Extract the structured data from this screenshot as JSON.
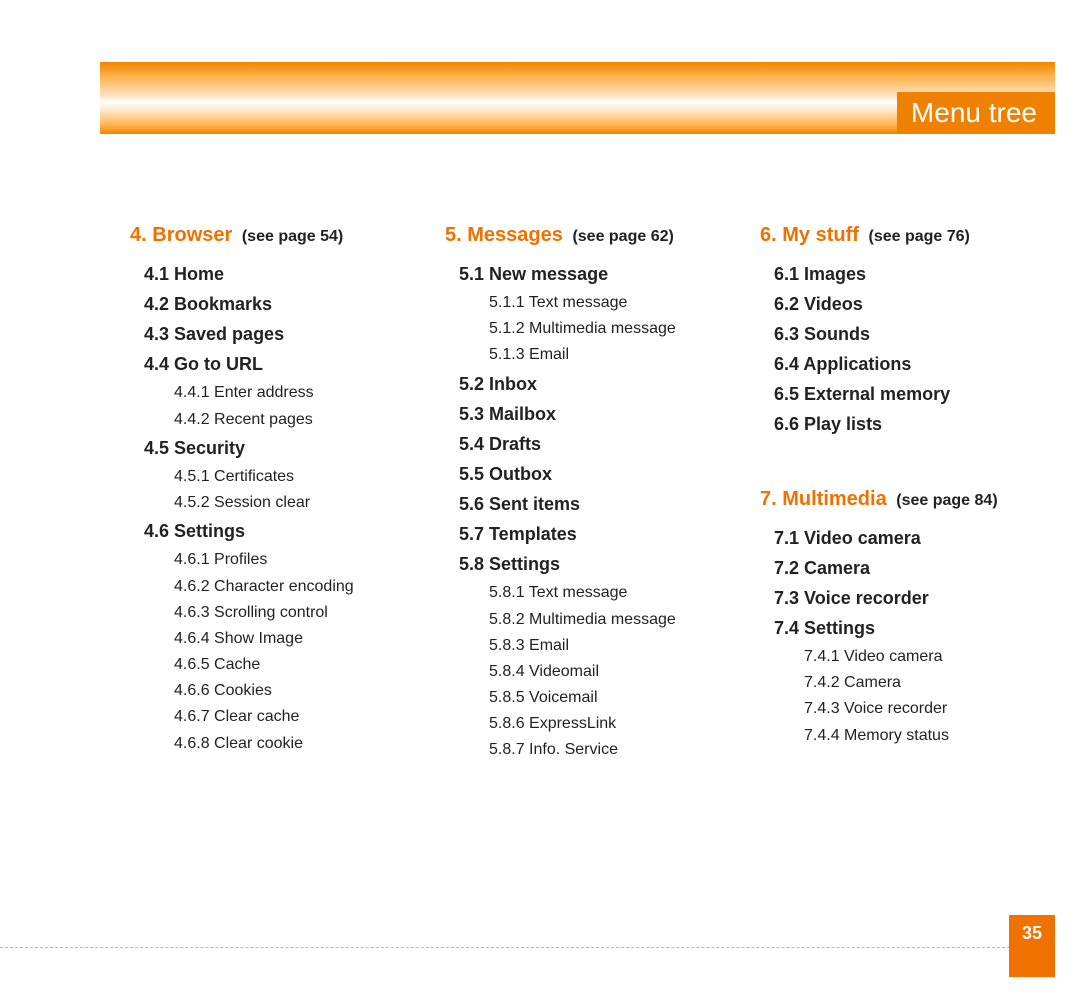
{
  "title": "Menu tree",
  "page_number": "35",
  "columns": [
    {
      "sections": [
        {
          "num": "4.",
          "name": "Browser",
          "see": "see page 54)",
          "items": [
            {
              "t": "4.1 Home",
              "lvl": 2
            },
            {
              "t": "4.2 Bookmarks",
              "lvl": 2
            },
            {
              "t": "4.3 Saved pages",
              "lvl": 2
            },
            {
              "t": "4.4 Go to URL",
              "lvl": 2
            },
            {
              "t": "4.4.1 Enter address",
              "lvl": 3
            },
            {
              "t": "4.4.2 Recent pages",
              "lvl": 3
            },
            {
              "t": "4.5 Security",
              "lvl": 2
            },
            {
              "t": "4.5.1 Certificates",
              "lvl": 3
            },
            {
              "t": "4.5.2 Session clear",
              "lvl": 3
            },
            {
              "t": "4.6 Settings",
              "lvl": 2
            },
            {
              "t": "4.6.1 Profiles",
              "lvl": 3
            },
            {
              "t": "4.6.2 Character encoding",
              "lvl": 3
            },
            {
              "t": "4.6.3 Scrolling control",
              "lvl": 3
            },
            {
              "t": "4.6.4 Show Image",
              "lvl": 3
            },
            {
              "t": "4.6.5 Cache",
              "lvl": 3
            },
            {
              "t": "4.6.6 Cookies",
              "lvl": 3
            },
            {
              "t": "4.6.7 Clear cache",
              "lvl": 3
            },
            {
              "t": "4.6.8 Clear cookie",
              "lvl": 3
            }
          ]
        }
      ]
    },
    {
      "sections": [
        {
          "num": "5.",
          "name": "Messages",
          "see": "see page 62)",
          "items": [
            {
              "t": "5.1 New message",
              "lvl": 2
            },
            {
              "t": "5.1.1 Text message",
              "lvl": 3
            },
            {
              "t": "5.1.2 Multimedia message",
              "lvl": 3
            },
            {
              "t": "5.1.3 Email",
              "lvl": 3
            },
            {
              "t": "5.2 Inbox",
              "lvl": 2
            },
            {
              "t": "5.3 Mailbox",
              "lvl": 2
            },
            {
              "t": "5.4 Drafts",
              "lvl": 2
            },
            {
              "t": "5.5 Outbox",
              "lvl": 2
            },
            {
              "t": "5.6 Sent items",
              "lvl": 2
            },
            {
              "t": "5.7 Templates",
              "lvl": 2
            },
            {
              "t": "5.8 Settings",
              "lvl": 2
            },
            {
              "t": "5.8.1 Text message",
              "lvl": 3
            },
            {
              "t": "5.8.2 Multimedia message",
              "lvl": 3
            },
            {
              "t": "5.8.3 Email",
              "lvl": 3
            },
            {
              "t": "5.8.4 Videomail",
              "lvl": 3
            },
            {
              "t": "5.8.5 Voicemail",
              "lvl": 3
            },
            {
              "t": "5.8.6 ExpressLink",
              "lvl": 3
            },
            {
              "t": "5.8.7 Info. Service",
              "lvl": 3
            }
          ]
        }
      ]
    },
    {
      "sections": [
        {
          "num": "6.",
          "name": "My stuff",
          "see": "see page 76)",
          "items": [
            {
              "t": "6.1 Images",
              "lvl": 2
            },
            {
              "t": "6.2 Videos",
              "lvl": 2
            },
            {
              "t": "6.3 Sounds",
              "lvl": 2
            },
            {
              "t": "6.4 Applications",
              "lvl": 2
            },
            {
              "t": "6.5 External memory",
              "lvl": 2
            },
            {
              "t": "6.6 Play lists",
              "lvl": 2
            }
          ]
        },
        {
          "num": "7.",
          "name": "Multimedia",
          "see": "see page 84)",
          "items": [
            {
              "t": "7.1 Video camera",
              "lvl": 2
            },
            {
              "t": "7.2 Camera",
              "lvl": 2
            },
            {
              "t": "7.3 Voice recorder",
              "lvl": 2
            },
            {
              "t": "7.4 Settings",
              "lvl": 2
            },
            {
              "t": "7.4.1 Video camera",
              "lvl": 3
            },
            {
              "t": "7.4.2 Camera",
              "lvl": 3
            },
            {
              "t": "7.4.3 Voice recorder",
              "lvl": 3
            },
            {
              "t": "7.4.4 Memory status",
              "lvl": 3
            }
          ]
        }
      ]
    }
  ]
}
